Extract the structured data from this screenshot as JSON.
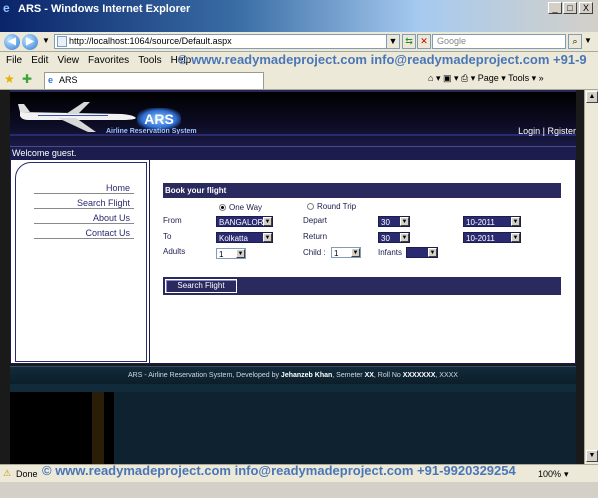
{
  "window": {
    "title": "ARS - Windows Internet Explorer",
    "min_label": "_",
    "max_label": "□",
    "close_label": "X"
  },
  "address": {
    "url": "http://localhost:1064/source/Default.aspx",
    "search_placeholder": "Google"
  },
  "menu": {
    "items": [
      "File",
      "Edit",
      "View",
      "Favorites",
      "Tools",
      "Help"
    ]
  },
  "watermark": {
    "top": "© www.readymadeproject.com info@readymadeproject.com +91-9",
    "bottom": "© www.readymadeproject.com info@readymadeproject.com +91-9920329254"
  },
  "tab": {
    "label": "ARS"
  },
  "commandbar": {
    "page_label": "Page",
    "tools_label": "Tools"
  },
  "site": {
    "logo_text": "ARS",
    "logo_subtitle": "Airline Reservation System",
    "login_label": "Login",
    "separator": "|",
    "register_label": "Rgister",
    "welcome": "Welcome guest."
  },
  "nav": {
    "items": [
      "Home",
      "Search Flight",
      "About Us",
      "Contact Us"
    ]
  },
  "booking": {
    "header": "Book your flight",
    "one_way_label": "One Way",
    "round_trip_label": "Round Trip",
    "trip_type": "one-way",
    "from_label": "From",
    "from_value": "BANGALOR",
    "to_label": "To",
    "to_value": "Kolkatta",
    "depart_label": "Depart",
    "depart_day": "30",
    "depart_month": "10-2011",
    "return_label": "Return",
    "return_day": "30",
    "return_month": "10-2011",
    "adults_label": "Adults",
    "adults_value": "1",
    "child_label": "Child :",
    "child_value": "1",
    "infants_label": "Infants",
    "infants_value": "",
    "search_button": "Search Flight"
  },
  "footer": {
    "text_prefix": "ARS - Airline Reservation System, Developed by ",
    "author": "Jehanzeb Khan",
    "text_mid1": ", Semeter ",
    "semester": "XX",
    "text_mid2": ", Roll No ",
    "roll": "XXXXXXX",
    "text_suffix": ", XXXX"
  },
  "status": {
    "done": "Done",
    "zoom": "100%"
  },
  "colors": {
    "site_navy": "#2a2a5f",
    "header_dark": "#000000",
    "footer_teal": "#122b3a"
  }
}
